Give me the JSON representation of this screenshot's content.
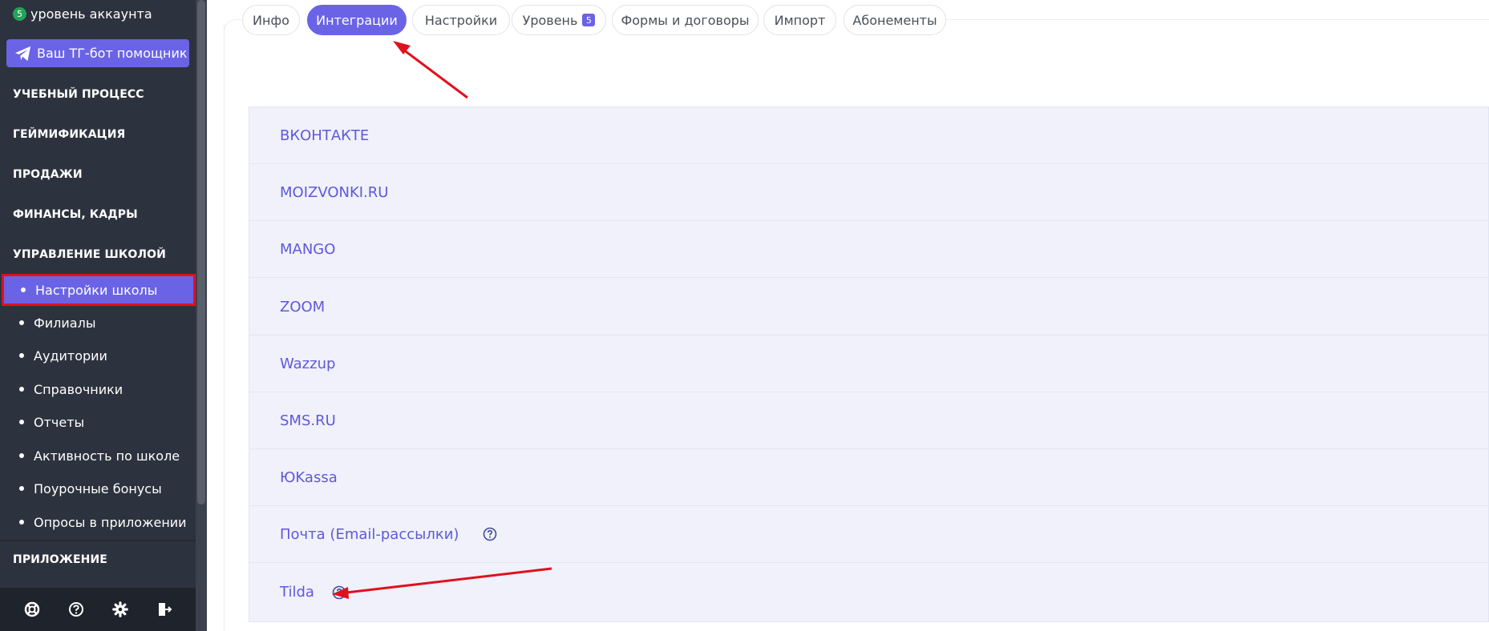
{
  "sidebar": {
    "account_level_badge": "5",
    "account_level_text": "уровень аккаунта",
    "tg_bot_button": "Ваш ТГ-бот помощник",
    "sections": {
      "learning": "УЧЕБНЫЙ ПРОЦЕСС",
      "gamification": "ГЕЙМИФИКАЦИЯ",
      "sales": "ПРОДАЖИ",
      "finance": "ФИНАНСЫ, КАДРЫ",
      "school_management": "УПРАВЛЕНИЕ ШКОЛОЙ",
      "app": "ПРИЛОЖЕНИЕ"
    },
    "submenu": [
      "Настройки школы",
      "Филиалы",
      "Аудитории",
      "Справочники",
      "Отчеты",
      "Активность по школе",
      "Поурочные бонусы",
      "Опросы в приложении"
    ],
    "bottom_icons": [
      "support-icon",
      "help-icon",
      "gear-icon",
      "logout-icon"
    ],
    "accent_color": "#6b63e6",
    "background_color": "#2d333e"
  },
  "tabs": {
    "items": [
      "Инфо",
      "Интеграции",
      "Настройки",
      "Уровень",
      "Формы и договоры",
      "Импорт",
      "Абонементы"
    ],
    "level_count": "5",
    "active": "Интеграции"
  },
  "integrations": {
    "items": [
      "ВКОНТАКТЕ",
      "MOIZVONKI.RU",
      "MANGO",
      "ZOOM",
      "Wazzup",
      "SMS.RU",
      "ЮKassa",
      "Почта (Email-рассылки)",
      "Tilda"
    ],
    "help_icons_on": [
      "Почта (Email-рассылки)",
      "Tilda"
    ],
    "link_color": "#5f58dc"
  },
  "annotations": {
    "highlight_color": "#e0101e"
  }
}
